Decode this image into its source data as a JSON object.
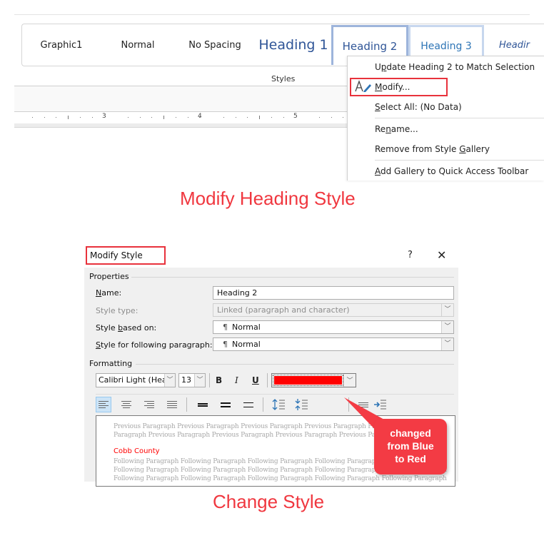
{
  "ribbon": {
    "styles_gallery": [
      {
        "label": "Graphic1"
      },
      {
        "label": "Normal"
      },
      {
        "label": "No Spacing"
      },
      {
        "label": "Heading 1"
      },
      {
        "label": "Heading 2"
      },
      {
        "label": "Heading 3"
      },
      {
        "label": "Headir"
      }
    ],
    "group_label": "Styles",
    "ruler_numbers": [
      "3",
      "4",
      "5"
    ]
  },
  "context_menu": {
    "items": [
      {
        "pre": "U",
        "ul": "p",
        "post": "date Heading 2 to Match Selection"
      },
      {
        "pre": "",
        "ul": "M",
        "post": "odify...",
        "icon": "modify-style-icon"
      },
      {
        "pre": "",
        "ul": "S",
        "post": "elect All: (No Data)"
      },
      {
        "pre": "Re",
        "ul": "n",
        "post": "ame..."
      },
      {
        "pre": "Remove from Style ",
        "ul": "G",
        "post": "allery"
      },
      {
        "pre": "",
        "ul": "A",
        "post": "dd Gallery to Quick Access Toolbar"
      }
    ]
  },
  "captions": {
    "top": "Modify Heading Style",
    "bottom": "Change Style"
  },
  "dialog": {
    "title": "Modify Style",
    "help": "?",
    "close": "✕",
    "properties": {
      "group_label": "Properties",
      "name_label_ul": "N",
      "name_label_rest": "ame:",
      "name_value": "Heading 2",
      "style_type_label": "Style type:",
      "style_type_value": "Linked (paragraph and character)",
      "based_on_label_pre": "Style ",
      "based_on_label_ul": "b",
      "based_on_label_post": "ased on:",
      "based_on_value": "Normal",
      "following_label_ul": "S",
      "following_label_rest": "tyle for following paragraph:",
      "following_value": "Normal",
      "pilcrow": "¶"
    },
    "formatting": {
      "group_label": "Formatting",
      "font": "Calibri Light (Headings)",
      "size": "13",
      "bold": "B",
      "italic": "I",
      "underline": "U",
      "font_color": "#ff0000"
    },
    "preview": {
      "previous_line_1": "Previous Paragraph Previous Paragraph Previous Paragraph Previous Paragraph Previous Paragraph",
      "previous_line_2": "Paragraph Previous Paragraph Previous Paragraph Previous Paragraph Previous Paragraph",
      "sample": "Cobb County",
      "following_line_1": "Following Paragraph Following Paragraph Following Paragraph Following Paragraph Following Paragraph",
      "following_line_2": "Following Paragraph Following Paragraph Following Paragraph Following Paragraph Following Paragraph",
      "following_line_3": "Following Paragraph Following Paragraph Following Paragraph Following Paragraph Following Paragraph"
    }
  },
  "callout": {
    "text_line_1": "changed",
    "text_line_2": "from Blue",
    "text_line_3": "to Red"
  },
  "colors": {
    "annotation_red": "#f0373f",
    "heading_blue": "#2f5597",
    "font_color_red": "#ff0000"
  }
}
